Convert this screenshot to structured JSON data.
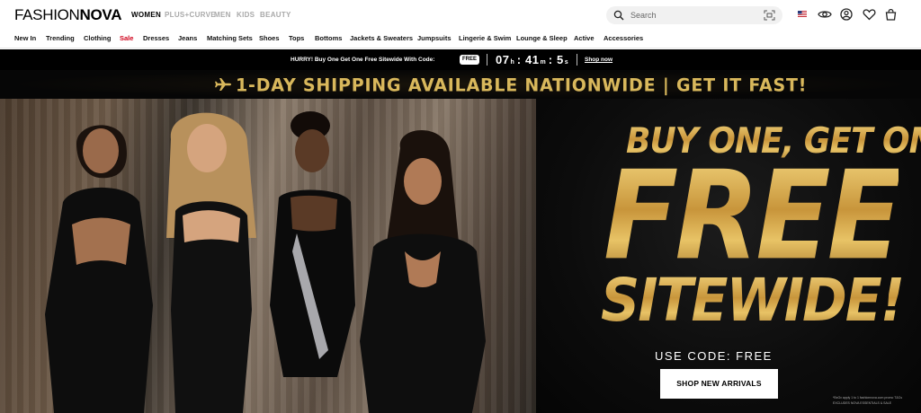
{
  "header": {
    "logo_part1": "FASHION",
    "logo_part2": "NOVA",
    "genders": [
      "WOMEN",
      "PLUS+CURVE",
      "MEN",
      "KIDS",
      "BEAUTY"
    ],
    "search_placeholder": "Search",
    "icons": [
      "us-flag-icon",
      "eye-icon",
      "account-icon",
      "heart-icon",
      "bag-icon"
    ]
  },
  "nav": {
    "items": [
      "New In",
      "Trending",
      "Clothing",
      "Sale",
      "Dresses",
      "Jeans",
      "Matching Sets",
      "Shoes",
      "Tops",
      "Bottoms",
      "Jackets & Sweaters",
      "Jumpsuits",
      "Lingerie & Swim",
      "Lounge & Sleep",
      "Active",
      "Accessories"
    ],
    "sale_color": "#d0021b"
  },
  "promo": {
    "text": "HURRY! Buy One Get One Free Sitewide With Code:",
    "code": "FREE",
    "hours": "07",
    "hours_unit": "h",
    "minutes": "41",
    "minutes_unit": "m",
    "seconds": "5",
    "seconds_unit": "s",
    "link": "Shop now"
  },
  "shipping_banner": {
    "text": "1-DAY SHIPPING AVAILABLE NATIONWIDE  |  GET IT FAST!"
  },
  "hero": {
    "line1": "BUY ONE, GET ONE",
    "line2": "FREE",
    "line3": "SITEWIDE!",
    "code_text": "USE CODE: FREE",
    "cta": "SHOP NEW ARRIVALS",
    "fine_print_1": "*BxGx apply 1 to 1 fashionnova.com promo T&Cs",
    "fine_print_2": "EXCLUDES NOVA ESSENTIALS & SALE",
    "gold_color": "#d4a94c"
  }
}
